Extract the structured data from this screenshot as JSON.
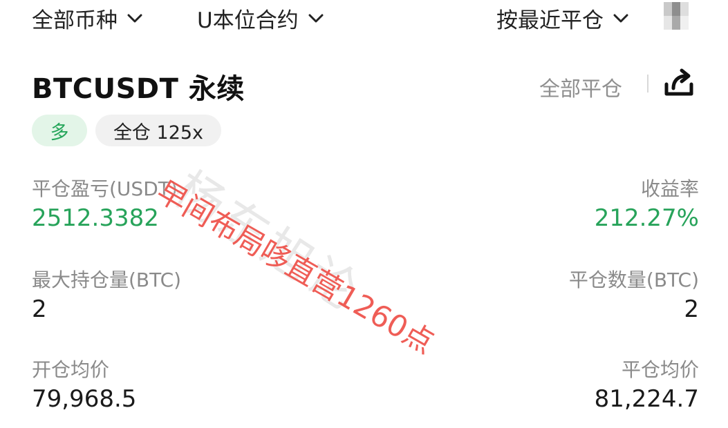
{
  "filters": {
    "coin_label": "全部币种",
    "contract_label": "U本位合约",
    "sort_label": "按最近平仓"
  },
  "position": {
    "symbol": "BTCUSDT 永续",
    "close_all_label": "全部平仓",
    "side_tag": "多",
    "margin_tag": "全仓 125x"
  },
  "stats": {
    "pnl_label": "平仓盈亏(USDT)",
    "pnl_value": "2512.3382",
    "roi_label": "收益率",
    "roi_value": "212.27%",
    "max_pos_label": "最大持仓量(BTC)",
    "max_pos_value": "2",
    "closed_qty_label": "平仓数量(BTC)",
    "closed_qty_value": "2",
    "open_avg_label": "开仓均价",
    "open_avg_value": "79,968.5",
    "close_avg_label": "平仓均价",
    "close_avg_value": "81,224.7"
  },
  "overlays": {
    "watermark_text": "杨东旭论",
    "stamp_text": "早间布局哆直营1260点"
  },
  "colors": {
    "profit_green": "#27a35a",
    "stamp_red": "#ec423a",
    "tag_green_bg": "#e3f5e8"
  },
  "icons": {
    "dropdown": "chevron-down-icon",
    "filter": "filter-icon",
    "share": "share-icon"
  }
}
